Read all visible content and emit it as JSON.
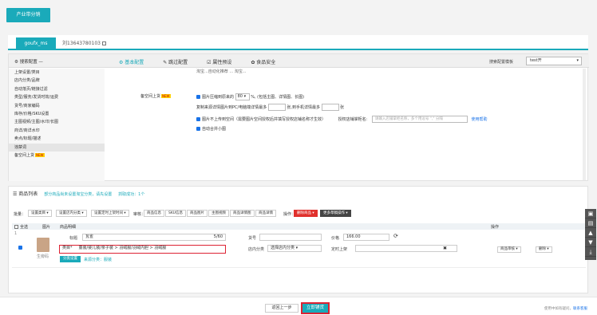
{
  "top_button": "产业带分销",
  "shop_tabs": [
    {
      "label": "goufx_ms"
    },
    {
      "label": "刘13643780103"
    }
  ],
  "config": {
    "header_left": "搜索配置 —",
    "nav": [
      "基本配置",
      "跳过配置",
      "属性预设",
      "食品安全"
    ],
    "template_label": "搜索配置模板",
    "template_value": "test开",
    "side_items": [
      "上架设置/类目",
      "店内分类/品牌",
      "自动落页/链接过滤",
      "类型/服务/发货时效/运费",
      "货号/商家编码",
      "库存/价格/SKU设置",
      "主图视频/主图/水印/长图",
      "商详/商详水印",
      "卖点/标题/描述",
      "违禁词",
      "备空间上货"
    ],
    "side_hot_badge": "NEW",
    "body": {
      "cut_top": "淘宝...自动化推荐 ... 淘宝...",
      "section_label": "备空间上货",
      "hot": "NEW",
      "compress_text": "图片压缩到原来的",
      "compress_value": "80",
      "compress_suffix": "%, (包括主图、详情图、长图)",
      "copy_text_a": "复制来源详情图片到PC/电脑端详情最多",
      "copy_text_b": "张,到手机详情最多",
      "copy_text_c": "张",
      "no_upload_text": "图片不上传到空间（需要图片空间授权后并填写授权店铺名称才生效）",
      "auth_label": "授权店铺掌柜名:",
      "auth_placeholder": "请输入店铺掌柜名称，多个用逗号 \",\" 分隔",
      "help_link": "使用帮助",
      "auto_thumb": "自动合并小图"
    }
  },
  "products": {
    "title": "商品列表",
    "subtitle": "部分商品尚未设置淘宝分类，请先设置",
    "count_text": "抓取成功：1个",
    "toolbar": {
      "batch_label": "批量：",
      "buttons": [
        "设置类目",
        "设置店内分类",
        "设置定时上架时间"
      ],
      "audit_label": "审核：",
      "audit_buttons": [
        "商品信息",
        "SKU信息",
        "商品图片",
        "主图视频",
        "商品详情图",
        "商品详情"
      ],
      "op_label": "操作：",
      "delete_btn": "删除商品 ▾",
      "publish_btn": "更多草稿操作 ▾"
    },
    "head": {
      "all": "全选",
      "image": "图片",
      "info": "商品明细",
      "action": "操作"
    },
    "row": {
      "index": "1",
      "thumb_caption": "生旁码",
      "title_label": "标题",
      "title_value": "瓦雀",
      "title_count": "5/60",
      "category_label": "类目*",
      "category_value": "童装/婴儿装/亲子装 > 羽绒服/羽绒内胆 > 羽绒服",
      "tag_primary": "分类设置",
      "tag_status": "来源分类：服装",
      "sku_label": "货号",
      "shop_cat_label": "店内分类",
      "shop_cat_value": "选择店内分类",
      "price_label": "价格",
      "price_value": "166.00",
      "schedule_label": "定时上架",
      "audit_btn": "商品审核 ▾",
      "delete_btn": "删除 ▾"
    }
  },
  "footer": {
    "prev": "返回上一步",
    "submit": "立即铺货",
    "help_text": "使用中如有疑问，",
    "help_link": "联系客服"
  }
}
